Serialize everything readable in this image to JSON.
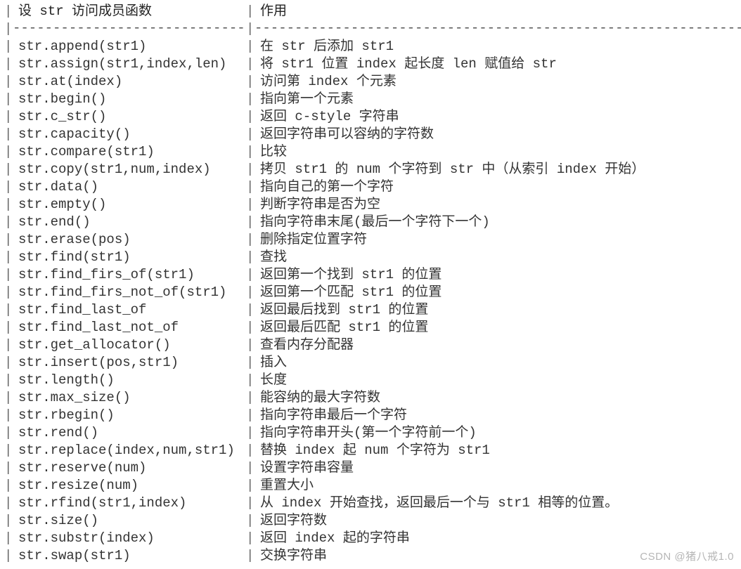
{
  "headers": {
    "col1": "设 str 访问成员函数",
    "col2": "作用"
  },
  "dashes": {
    "col1": "--------------------------------",
    "col2": "---------------------------------------------------------------"
  },
  "rows": [
    {
      "fn": "str.append(str1)",
      "desc": "在 str 后添加 str1"
    },
    {
      "fn": "str.assign(str1,index,len)",
      "desc": "将 str1 位置 index 起长度 len 赋值给 str"
    },
    {
      "fn": "str.at(index)",
      "desc": "访问第 index 个元素"
    },
    {
      "fn": "str.begin()",
      "desc": "指向第一个元素"
    },
    {
      "fn": "str.c_str()",
      "desc": "返回 c-style 字符串"
    },
    {
      "fn": "str.capacity()",
      "desc": "返回字符串可以容纳的字符数"
    },
    {
      "fn": "str.compare(str1)",
      "desc": "比较"
    },
    {
      "fn": "str.copy(str1,num,index)",
      "desc": "拷贝 str1 的 num 个字符到 str 中（从索引 index 开始）"
    },
    {
      "fn": "str.data()",
      "desc": "指向自己的第一个字符"
    },
    {
      "fn": "str.empty()",
      "desc": "判断字符串是否为空"
    },
    {
      "fn": "str.end()",
      "desc": "指向字符串末尾(最后一个字符下一个)"
    },
    {
      "fn": "str.erase(pos)",
      "desc": "删除指定位置字符"
    },
    {
      "fn": "str.find(str1)",
      "desc": "查找"
    },
    {
      "fn": "str.find_firs_of(str1)",
      "desc": "返回第一个找到 str1 的位置"
    },
    {
      "fn": "str.find_firs_not_of(str1)",
      "desc": "返回第一个匹配 str1 的位置"
    },
    {
      "fn": "str.find_last_of",
      "desc": "返回最后找到 str1 的位置"
    },
    {
      "fn": "str.find_last_not_of",
      "desc": "返回最后匹配 str1 的位置"
    },
    {
      "fn": "str.get_allocator()",
      "desc": "查看内存分配器"
    },
    {
      "fn": "str.insert(pos,str1)",
      "desc": "插入"
    },
    {
      "fn": "str.length()",
      "desc": "长度"
    },
    {
      "fn": "str.max_size()",
      "desc": "能容纳的最大字符数"
    },
    {
      "fn": "str.rbegin()",
      "desc": "指向字符串最后一个字符"
    },
    {
      "fn": "str.rend()",
      "desc": "指向字符串开头(第一个字符前一个)"
    },
    {
      "fn": "str.replace(index,num,str1)",
      "desc": "替换 index 起 num 个字符为 str1"
    },
    {
      "fn": "str.reserve(num)",
      "desc": "设置字符串容量"
    },
    {
      "fn": "str.resize(num)",
      "desc": "重置大小"
    },
    {
      "fn": "str.rfind(str1,index)",
      "desc": "从 index 开始查找，返回最后一个与 str1 相等的位置。"
    },
    {
      "fn": "str.size()",
      "desc": "返回字符数"
    },
    {
      "fn": "str.substr(index)",
      "desc": "返回 index 起的字符串"
    },
    {
      "fn": "str.swap(str1)",
      "desc": "交换字符串"
    }
  ],
  "watermark": "CSDN @猪八戒1.0"
}
